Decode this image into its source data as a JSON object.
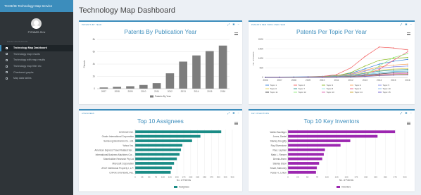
{
  "brand": "TCOE/IE Technology Map Service",
  "user": {
    "name": "PYRAMIS JIN ▾"
  },
  "sidebar": {
    "header": "MAIN NAVIGATION",
    "items": [
      {
        "label": "Technology Map Dashboard",
        "active": true,
        "icon": "dashboard-icon"
      },
      {
        "label": "Technology map results",
        "active": false,
        "icon": "list-icon"
      },
      {
        "label": "Technology with map results",
        "active": false,
        "icon": "table-icon"
      },
      {
        "label": "Technology map filter etc",
        "active": false,
        "icon": "filter-icon"
      },
      {
        "label": "Chartsand graphs",
        "active": false,
        "icon": "chart-icon"
      },
      {
        "label": "Map data tables",
        "active": false,
        "icon": "map-icon"
      }
    ]
  },
  "page": {
    "title": "Technology Map Dashboard"
  },
  "colors": {
    "accent": "#3c8dbc",
    "bar_gray": "#7d7d7d",
    "teal": "#1a8c86",
    "purple": "#9c27b0"
  },
  "panels": {
    "year": {
      "header": "PATENTS BY YEAR",
      "chart_data": {
        "type": "bar",
        "title": "Patents By Publication Year",
        "ylabel": "Patents",
        "categories": [
          "2007",
          "2008",
          "2009",
          "2010",
          "2011",
          "2012",
          "2013",
          "2014",
          "2015",
          "2016"
        ],
        "series": [
          {
            "name": "Patents By Year",
            "values": [
              2,
              3,
              4,
              6,
              9,
              25,
              44,
              54,
              61,
              70
            ]
          }
        ],
        "ylim": [
          0,
          80
        ],
        "yticks": [
          0,
          20,
          40,
          60,
          80
        ],
        "ytick_labels": [
          "0",
          "2k",
          "4k",
          "6k",
          "8k"
        ],
        "legend": "bottom"
      }
    },
    "topic": {
      "header": "PATENTS PER TOPIC PER YEAR",
      "chart_data": {
        "type": "line",
        "title": "Patents Per Topic Per Year",
        "ylabel": "No. of Patents",
        "x": [
          "2006",
          "2007",
          "2008",
          "2009",
          "2010",
          "2011",
          "2012",
          "2013",
          "2014",
          "2015",
          "2016"
        ],
        "ylim": [
          0,
          2000
        ],
        "yticks": [
          0,
          500,
          1000,
          1500,
          2000
        ],
        "series": [
          {
            "name": "Topic 1",
            "color": "#2f7ed8",
            "values": [
              20,
              25,
              30,
              40,
              60,
              100,
              220,
              450,
              700,
              850,
              950
            ]
          },
          {
            "name": "Topic 2",
            "color": "#f45b5b",
            "values": [
              10,
              15,
              20,
              30,
              50,
              150,
              500,
              1100,
              1600,
              1550,
              1450
            ]
          },
          {
            "name": "Topic 3",
            "color": "#8bbc21",
            "values": [
              10,
              12,
              18,
              25,
              40,
              90,
              250,
              600,
              900,
              1000,
              1050
            ]
          },
          {
            "name": "Topic 4",
            "color": "#f7a35c",
            "values": [
              5,
              10,
              15,
              22,
              35,
              70,
              180,
              380,
              550,
              650,
              700
            ]
          },
          {
            "name": "Topic 5",
            "color": "#8085e9",
            "values": [
              5,
              8,
              12,
              18,
              30,
              60,
              150,
              330,
              480,
              560,
              600
            ]
          },
          {
            "name": "Topic 6",
            "color": "#e4d354",
            "values": [
              5,
              7,
              10,
              15,
              25,
              50,
              120,
              260,
              380,
              440,
              470
            ]
          },
          {
            "name": "Topic 7",
            "color": "#2b908f",
            "values": [
              4,
              6,
              9,
              13,
              22,
              45,
              100,
              220,
              330,
              390,
              420
            ]
          },
          {
            "name": "Topic 8",
            "color": "#91e8e1",
            "values": [
              3,
              5,
              8,
              11,
              18,
              35,
              80,
              170,
              260,
              320,
              350
            ]
          },
          {
            "name": "Topic 9",
            "color": "#f15c80",
            "values": [
              3,
              5,
              7,
              10,
              15,
              30,
              70,
              160,
              420,
              900,
              1350
            ]
          },
          {
            "name": "Topic 10",
            "color": "#7cb5ec",
            "values": [
              2,
              4,
              6,
              9,
              13,
              25,
              60,
              140,
              230,
              300,
              330
            ]
          },
          {
            "name": "Topic 11",
            "color": "#434348",
            "values": [
              2,
              3,
              5,
              7,
              11,
              20,
              45,
              110,
              180,
              240,
              270
            ]
          },
          {
            "name": "Topic 12",
            "color": "#90ed7d",
            "values": [
              2,
              3,
              4,
              6,
              9,
              16,
              35,
              90,
              600,
              1050,
              1250
            ]
          },
          {
            "name": "Topic 13",
            "color": "#e066b3",
            "values": [
              1,
              2,
              3,
              5,
              8,
              14,
              30,
              80,
              140,
              190,
              210
            ]
          },
          {
            "name": "Topic 14",
            "color": "#c9a227",
            "values": [
              1,
              2,
              3,
              4,
              6,
              10,
              25,
              60,
              110,
              150,
              170
            ]
          },
          {
            "name": "Topic 15",
            "color": "#6a5acd",
            "values": [
              1,
              1,
              2,
              3,
              5,
              8,
              20,
              50,
              90,
              120,
              140
            ]
          }
        ],
        "legend": "bottom"
      }
    },
    "assignees": {
      "header": "ASSIGNEES",
      "chart_data": {
        "type": "bar",
        "orientation": "horizontal",
        "title": "Top 10 Assignees",
        "xlabel": "No. of Patents",
        "categories": [
          "GOOGLE INC.",
          "Oracle International Corporation",
          "Samsung Electronics Co., Ltd.",
          "Yahoo! Inc.",
          "American Express Travel Related Ser...",
          "International Business Machines Cor...",
          "Sharebuilder Research Pty Ltd",
          "Microsoft Corporation",
          "AT&T Intellectual Property I, L.P.",
          "CITRIX SYSTEMS, INC."
        ],
        "series": [
          {
            "name": "Assignees",
            "values": [
              310,
              235,
              205,
              170,
              165,
              160,
              150,
              140,
              132,
              128
            ]
          }
        ],
        "xlim": [
          0,
          350
        ],
        "xticks": [
          0,
          25,
          50,
          75,
          100,
          125,
          150,
          175,
          200,
          225,
          250,
          275,
          300,
          325,
          350
        ],
        "legend": "bottom"
      }
    },
    "inventors": {
      "header": "KEY INVENTORS",
      "chart_data": {
        "type": "bar",
        "orientation": "horizontal",
        "title": "Top 10 Key Inventors",
        "xlabel": "No. of Patents",
        "categories": [
          "Walter Bachtiger",
          "Jones, Daniel",
          "Stanley Doughty",
          "Ray Silverstone",
          "Paul, Layman",
          "Mark L. Renner",
          "Dennis Ahern",
          "Stanley Elson",
          "Smart, Mahoney",
          "Rosie H., Linton"
        ],
        "series": [
          {
            "name": "Inventors",
            "values": [
              275,
              230,
              160,
              135,
              95,
              92,
              88,
              80,
              74,
              72
            ]
          }
        ],
        "xlim": [
          0,
          300
        ],
        "xticks": [
          0,
          25,
          50,
          75,
          100,
          125,
          150,
          175,
          200,
          225,
          250,
          275,
          300
        ],
        "legend": "bottom"
      }
    }
  }
}
